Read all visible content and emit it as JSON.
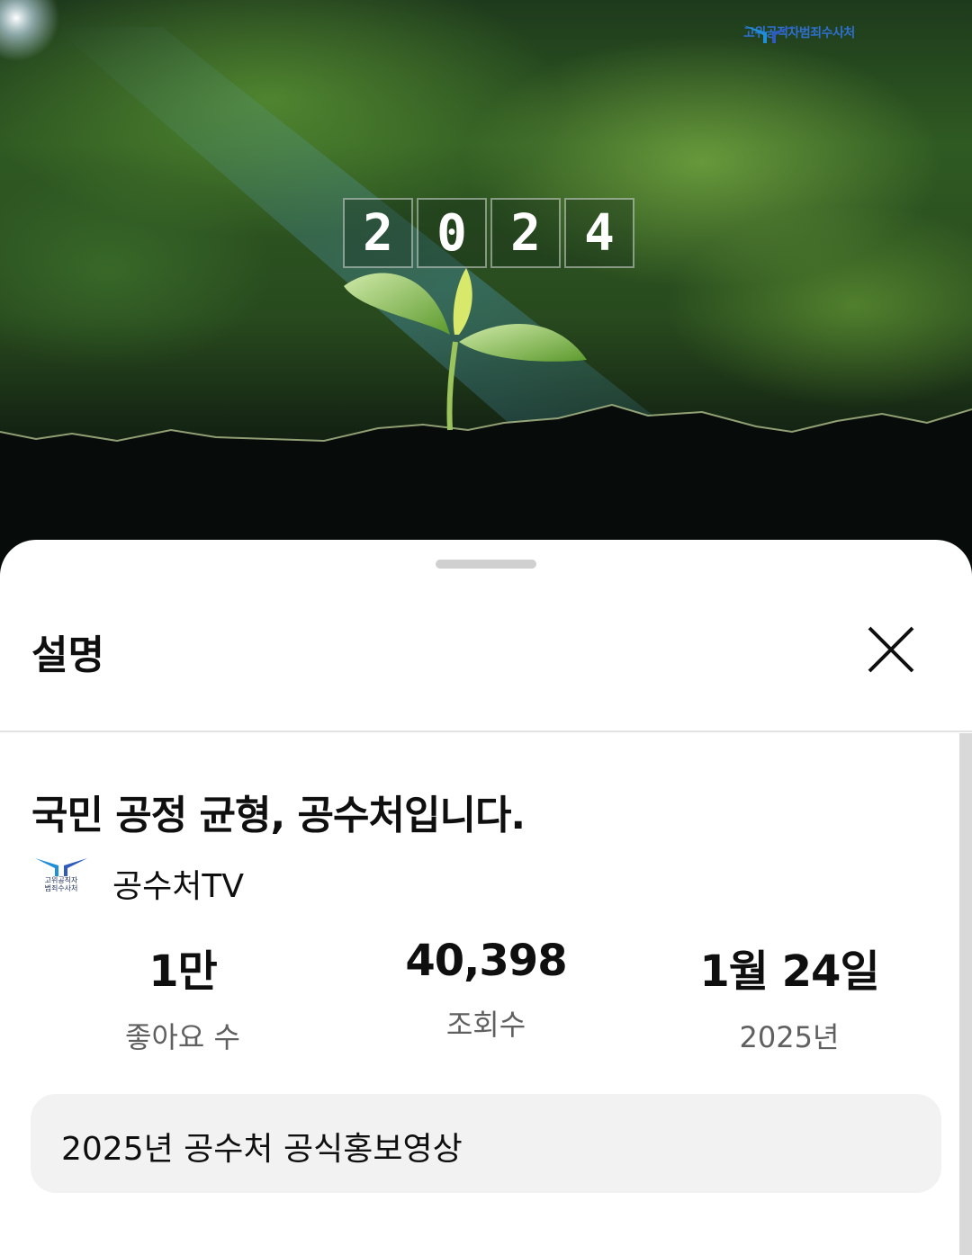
{
  "video": {
    "watermark": "고위공직자범죄수사처",
    "year_digits": [
      "2",
      "0",
      "2",
      "4"
    ]
  },
  "sheet": {
    "title": "설명",
    "close_icon": "close-icon"
  },
  "details": {
    "video_title": "국민 공정 균형, 공수처입니다.",
    "channel": {
      "name": "공수처TV",
      "avatar_text_line1": "고위공직자",
      "avatar_text_line2": "범죄수사처"
    },
    "stats": [
      {
        "value": "1만",
        "label": "좋아요 수"
      },
      {
        "value": "40,398",
        "label": "조회수"
      },
      {
        "value": "1월 24일",
        "label": "2025년"
      }
    ],
    "description": "2025년 공수처 공식홍보영상"
  },
  "colors": {
    "brand_blue": "#2f6fd0",
    "text_primary": "#0f0f0f",
    "text_secondary": "#606060",
    "desc_bg": "#f2f2f2"
  }
}
